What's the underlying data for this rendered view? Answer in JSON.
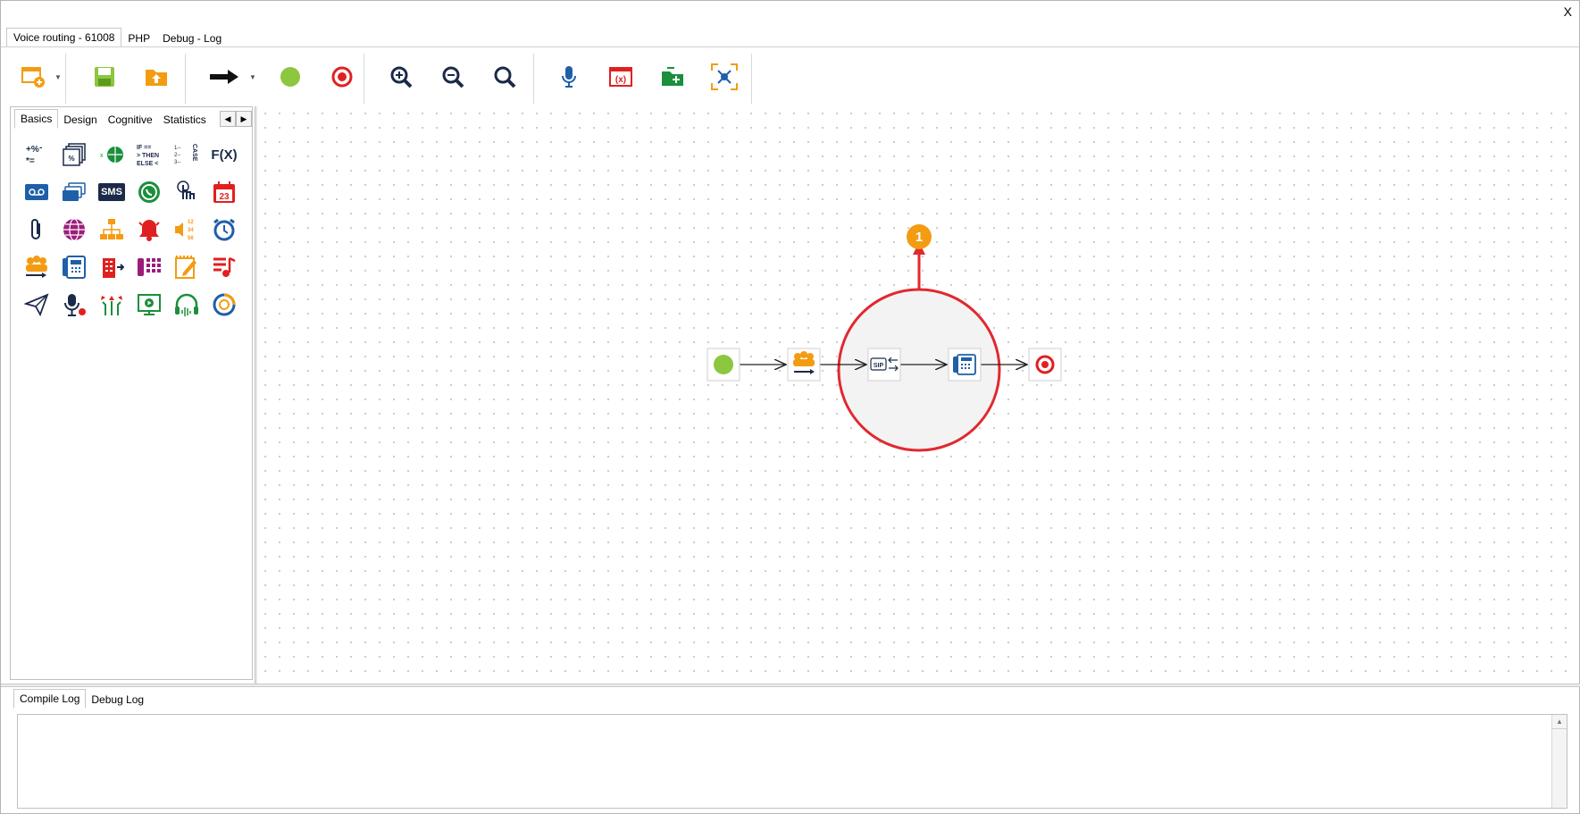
{
  "window": {
    "close_label": "X"
  },
  "tabs": [
    "Voice routing - 61008",
    "PHP",
    "Debug - Log"
  ],
  "toolbar": {
    "icons": [
      "new-flow-icon",
      "save-icon",
      "open-folder-icon",
      "arrow-connector-icon",
      "start-node-icon",
      "end-node-icon",
      "zoom-in-icon",
      "zoom-out-icon",
      "zoom-fit-icon",
      "microphone-icon",
      "variables-icon",
      "add-folder-icon",
      "fit-to-screen-icon"
    ]
  },
  "palette": {
    "tabs": [
      "Basics",
      "Design",
      "Cognitive",
      "Statistics"
    ],
    "icon_labels": {
      "fx": "F(X)",
      "sms": "SMS",
      "calendar": "23",
      "case": "CASE",
      "if": "IF ==",
      "then": "> THEN",
      "else": "ELSE <",
      "numbers": [
        "12",
        "34",
        "56"
      ]
    }
  },
  "canvas": {
    "nodes": [
      "start-node",
      "agent-group-node",
      "sip-transfer-node",
      "phone-node",
      "end-node"
    ],
    "annotation_number": "1",
    "sip_label": "SIP"
  },
  "bottom_tabs": [
    "Compile Log",
    "Debug Log"
  ],
  "colors": {
    "accent_orange": "#f39c12",
    "green": "#8dc63f",
    "red": "#e02020",
    "blue": "#1f5fa8",
    "navy": "#1b2a49"
  }
}
